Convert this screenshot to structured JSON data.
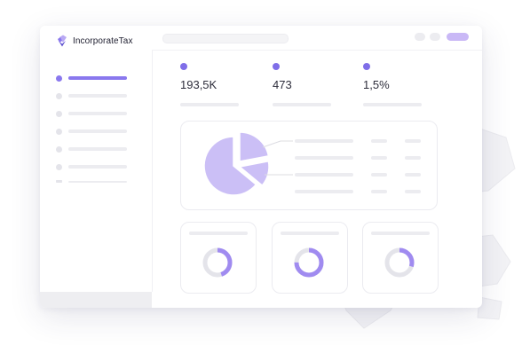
{
  "app": {
    "name": "IncorporateTax",
    "logo_icon": "stacked-diamond-logo-icon"
  },
  "sidebar": {
    "items": [
      {
        "id": "item-1",
        "active": true
      },
      {
        "id": "item-2",
        "active": false
      },
      {
        "id": "item-3",
        "active": false
      },
      {
        "id": "item-4",
        "active": false
      },
      {
        "id": "item-5",
        "active": false
      },
      {
        "id": "item-6",
        "active": false
      }
    ]
  },
  "topbar": {
    "search_placeholder": "",
    "pills": [
      {
        "id": "pill-1",
        "color": "#ececf0"
      },
      {
        "id": "pill-2",
        "color": "#ececf0"
      },
      {
        "id": "pill-3",
        "color": "#c9b8f6"
      }
    ]
  },
  "stats": [
    {
      "value": "193,5K"
    },
    {
      "value": "473"
    },
    {
      "value": "1,5%"
    }
  ],
  "pie": {
    "slices": [
      {
        "fraction": 0.64,
        "color": "#cbbff6"
      },
      {
        "fraction": 0.22,
        "color": "#cbbff6"
      },
      {
        "fraction": 0.14,
        "color": "#cbbff6"
      }
    ],
    "legend_rows": 4
  },
  "donuts": [
    {
      "fraction": 0.45,
      "color": "#a08bf0",
      "track": "#e4e4ea"
    },
    {
      "fraction": 0.75,
      "color": "#a08bf0",
      "track": "#e4e4ea"
    },
    {
      "fraction": 0.3,
      "color": "#a08bf0",
      "track": "#e4e4ea"
    }
  ],
  "colors": {
    "accent": "#7f6ee8",
    "accent_light": "#cbbff6",
    "placeholder": "#ececf0"
  }
}
